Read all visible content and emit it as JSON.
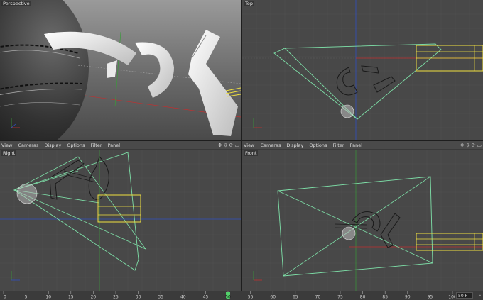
{
  "viewports": {
    "perspective": {
      "label": "Perspective"
    },
    "top": {
      "label": "Top"
    },
    "right": {
      "label": "Right"
    },
    "front": {
      "label": "Front"
    }
  },
  "menu": [
    "View",
    "Cameras",
    "Display",
    "Options",
    "Filter",
    "Panel"
  ],
  "nav_icons": [
    "move-icon",
    "pan-icon",
    "rotate-icon",
    "maximize-icon"
  ],
  "timeline": {
    "ticks": [
      "0",
      "5",
      "10",
      "15",
      "20",
      "25",
      "30",
      "35",
      "40",
      "45",
      "50",
      "55",
      "60",
      "65",
      "70",
      "75",
      "80",
      "85",
      "90",
      "95",
      "100"
    ],
    "current_frame": 50,
    "frame_field": "50 F",
    "end_label": "s"
  },
  "colors": {
    "viewport_bg": "#484848",
    "grid": "#525252",
    "camera_frustum": "#7ee0a8",
    "selection": "#f0e040",
    "axis_x": "#c03030",
    "axis_y": "#3a9a3a",
    "axis_z": "#3050c0",
    "playhead": "#52d06a"
  }
}
